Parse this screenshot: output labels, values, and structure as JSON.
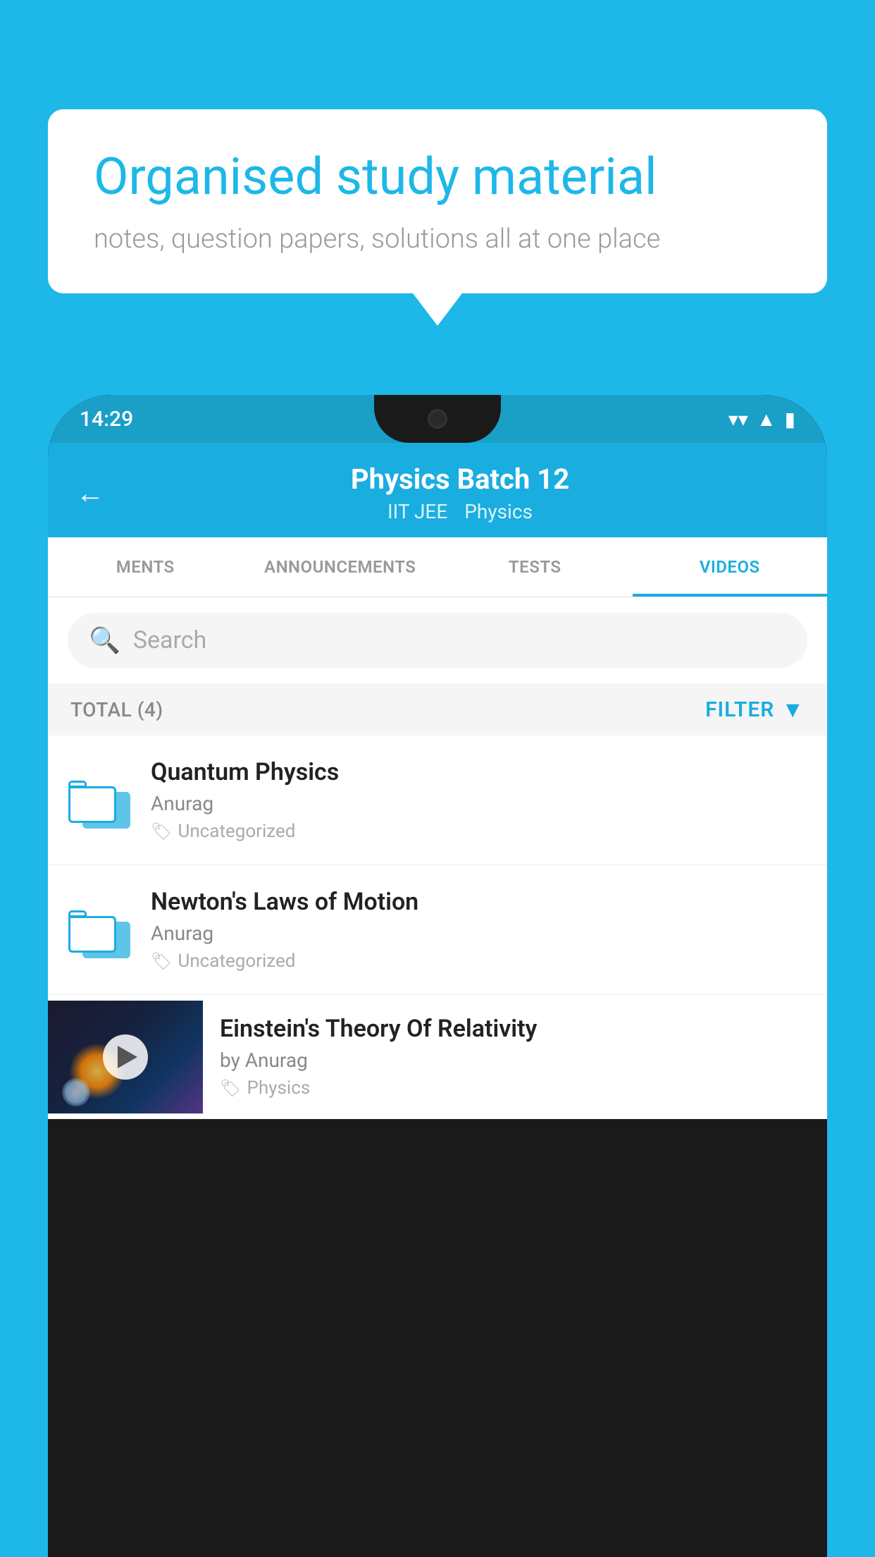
{
  "background_color": "#1DB8E8",
  "speech_bubble": {
    "heading": "Organised study material",
    "subtext": "notes, question papers, solutions all at one place"
  },
  "phone": {
    "status_bar": {
      "time": "14:29",
      "icons": [
        "wifi",
        "signal",
        "battery"
      ]
    },
    "header": {
      "back_label": "←",
      "title": "Physics Batch 12",
      "subtitle1": "IIT JEE",
      "subtitle2": "Physics"
    },
    "tabs": [
      {
        "label": "MENTS",
        "active": false
      },
      {
        "label": "ANNOUNCEMENTS",
        "active": false
      },
      {
        "label": "TESTS",
        "active": false
      },
      {
        "label": "VIDEOS",
        "active": true
      }
    ],
    "search": {
      "placeholder": "Search",
      "icon": "search-icon"
    },
    "filter_bar": {
      "total_label": "TOTAL (4)",
      "filter_label": "FILTER",
      "filter_icon": "filter-icon"
    },
    "videos": [
      {
        "id": 1,
        "title": "Quantum Physics",
        "author": "Anurag",
        "tag": "Uncategorized",
        "has_thumbnail": false
      },
      {
        "id": 2,
        "title": "Newton's Laws of Motion",
        "author": "Anurag",
        "tag": "Uncategorized",
        "has_thumbnail": false
      },
      {
        "id": 3,
        "title": "Einstein's Theory Of Relativity",
        "author": "by Anurag",
        "tag": "Physics",
        "has_thumbnail": true
      }
    ]
  }
}
